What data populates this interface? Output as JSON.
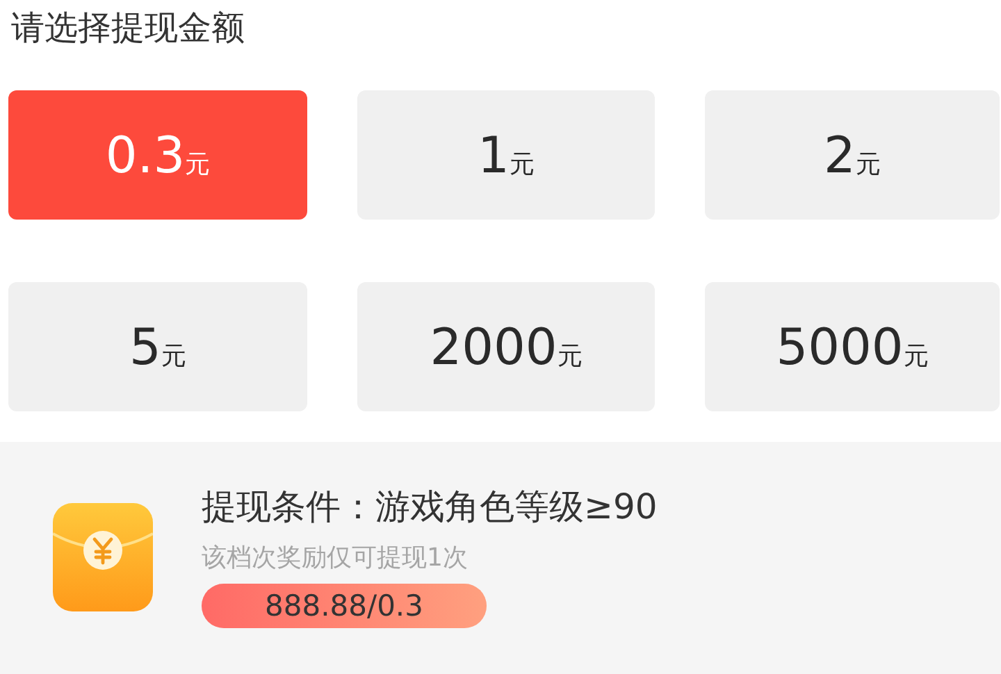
{
  "heading": "请选择提现金额",
  "amounts": [
    {
      "value": "0.3",
      "unit": "元",
      "selected": true
    },
    {
      "value": "1",
      "unit": "元",
      "selected": false
    },
    {
      "value": "2",
      "unit": "元",
      "selected": false
    },
    {
      "value": "5",
      "unit": "元",
      "selected": false
    },
    {
      "value": "2000",
      "unit": "元",
      "selected": false
    },
    {
      "value": "5000",
      "unit": "元",
      "selected": false
    }
  ],
  "condition": {
    "title": "提现条件：游戏角色等级≥90",
    "note": "该档次奖励仅可提现1次",
    "progress": {
      "label": "888.88/0.3",
      "level": 1
    }
  }
}
